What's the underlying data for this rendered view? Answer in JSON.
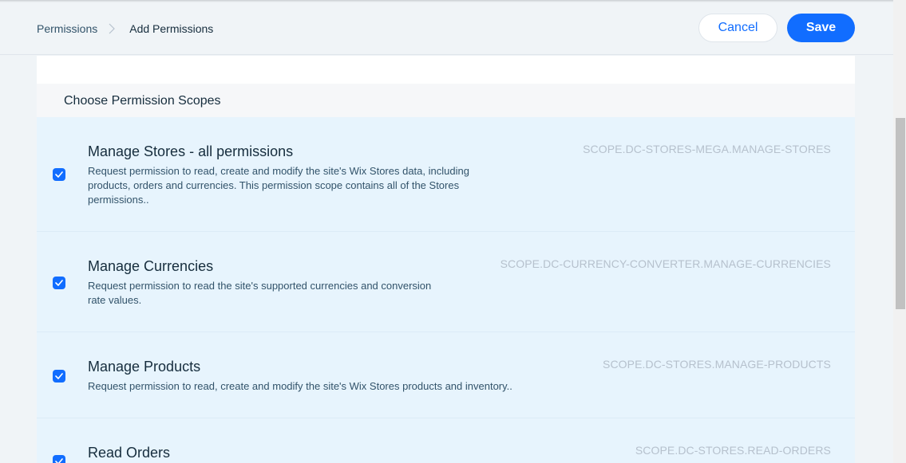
{
  "breadcrumb": {
    "items": [
      "Permissions",
      "Add Permissions"
    ]
  },
  "actions": {
    "cancel_label": "Cancel",
    "save_label": "Save"
  },
  "section": {
    "title": "Choose Permission Scopes"
  },
  "permissions": [
    {
      "title": "Manage Stores - all permissions",
      "description_lines": [
        "Request permission to read, create and modify the site's Wix Stores data, including",
        "products, orders and currencies. This permission scope contains all of the Stores",
        "permissions.."
      ],
      "scope": "SCOPE.DC-STORES-MEGA.MANAGE-STORES",
      "checked": true
    },
    {
      "title": "Manage Currencies",
      "description_lines": [
        "Request permission to read the site's supported currencies and conversion",
        "rate values."
      ],
      "scope": "SCOPE.DC-CURRENCY-CONVERTER.MANAGE-CURRENCIES",
      "checked": true
    },
    {
      "title": "Manage Products",
      "description_lines": [
        "Request permission to read, create and modify the site's Wix Stores products and inventory.."
      ],
      "scope": "SCOPE.DC-STORES.MANAGE-PRODUCTS",
      "checked": true
    },
    {
      "title": "Read Orders",
      "description_lines": [],
      "scope": "SCOPE.DC-STORES.READ-ORDERS",
      "checked": true
    }
  ],
  "colors": {
    "accent": "#116dff",
    "list_background": "#e7f4fd",
    "scope_text": "#b6c1cd"
  },
  "icons": {
    "breadcrumb_separator": "chevron-right-icon",
    "checkbox": "checkmark-icon"
  }
}
